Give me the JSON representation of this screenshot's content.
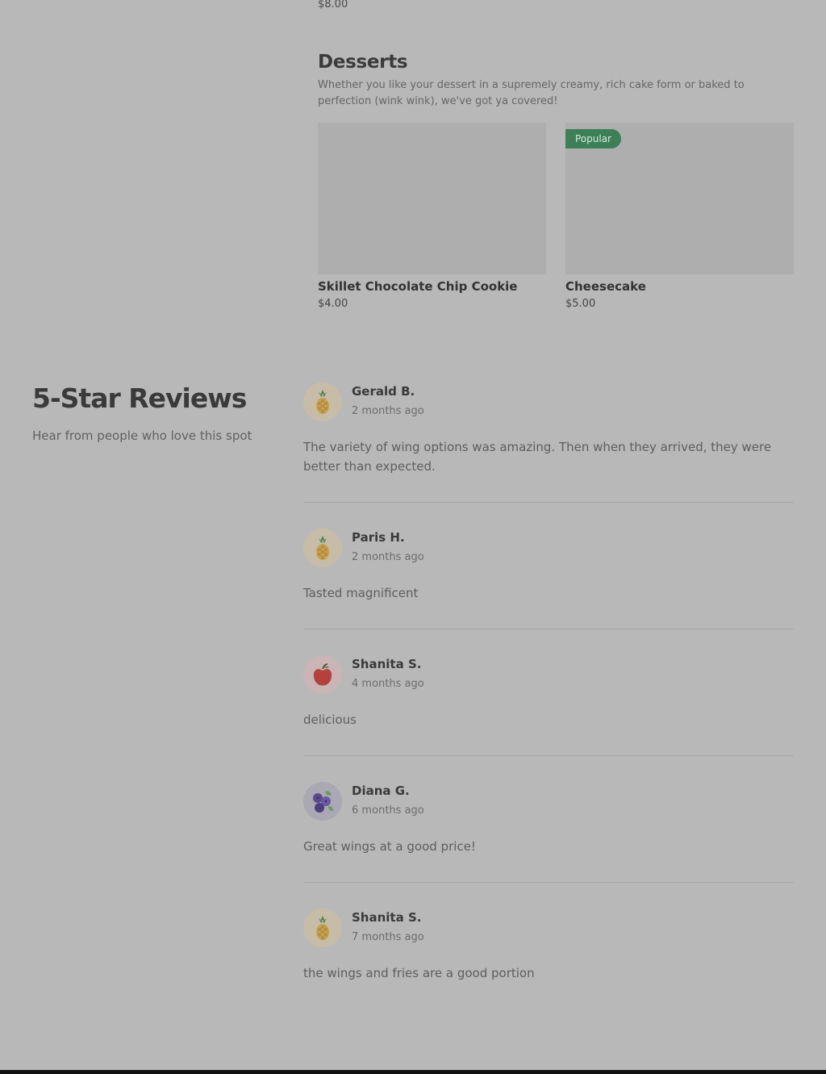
{
  "previous_item": {
    "price": "$8.00"
  },
  "desserts": {
    "title": "Desserts",
    "description": "Whether you like your dessert in a supremely creamy, rich cake form or baked to perfection (wink wink), we've got ya covered!",
    "items": [
      {
        "name": "Skillet Chocolate Chip Cookie",
        "price": "$4.00",
        "badge": ""
      },
      {
        "name": "Cheesecake",
        "price": "$5.00",
        "badge": "Popular"
      }
    ]
  },
  "reviews_section": {
    "title": "5-Star Reviews",
    "subtitle": "Hear from people who love this spot"
  },
  "reviews": [
    {
      "name": "Gerald B.",
      "date": "2 months ago",
      "avatar": "pineapple-icon",
      "text": "The variety of wing options was amazing. Then when they arrived, they were better than expected."
    },
    {
      "name": "Paris H.",
      "date": "2 months ago",
      "avatar": "pineapple-icon",
      "text": "Tasted magnificent"
    },
    {
      "name": "Shanita S.",
      "date": "4 months ago",
      "avatar": "apple-icon",
      "text": "delicious"
    },
    {
      "name": "Diana G.",
      "date": "6 months ago",
      "avatar": "blueberry-icon",
      "text": "Great wings at a good price!"
    },
    {
      "name": "Shanita S.",
      "date": "7 months ago",
      "avatar": "pineapple-icon",
      "text": "the wings and fries are a good portion"
    }
  ],
  "colors": {
    "badge": "#3d8058",
    "background": "#b8b8b8"
  }
}
